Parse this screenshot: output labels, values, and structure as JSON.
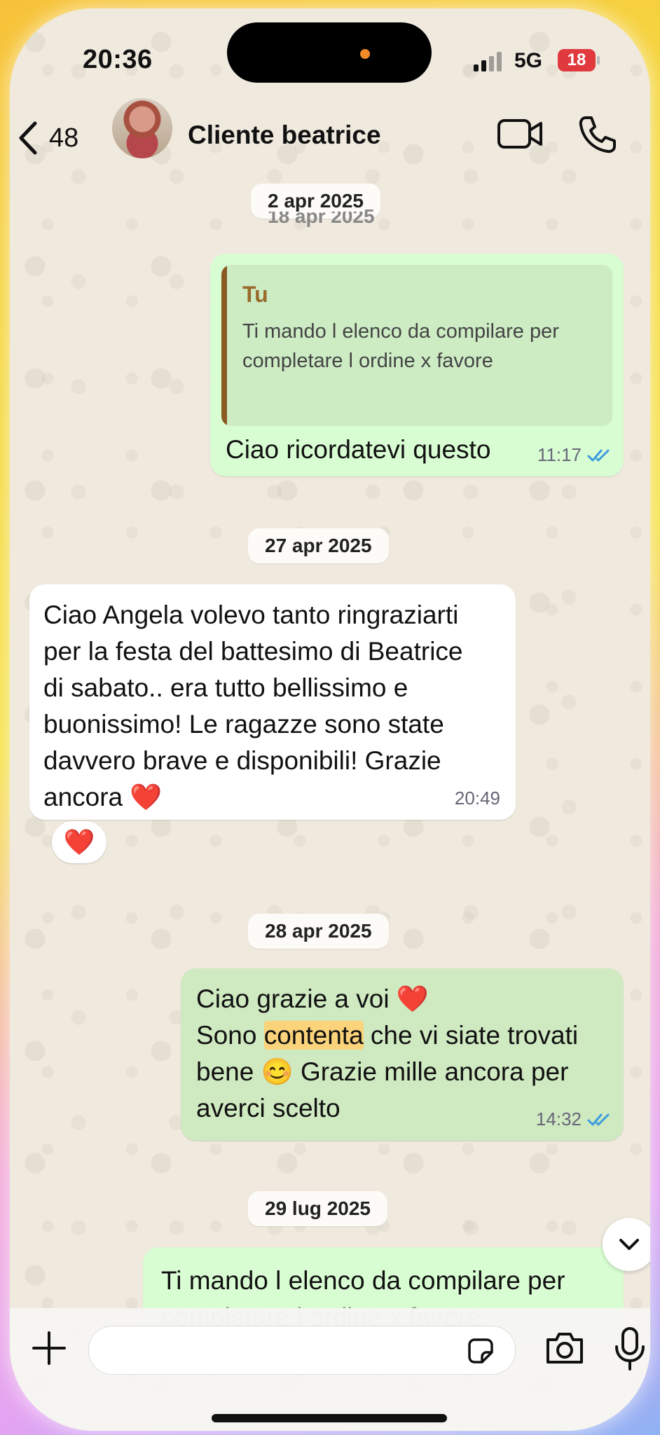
{
  "status_bar": {
    "time": "20:36",
    "network": "5G",
    "battery": "18"
  },
  "header": {
    "back_count": "48",
    "contact_name": "Cliente beatrice"
  },
  "dates": {
    "d1": "2 apr 2025",
    "d1_behind": "18 apr 2025",
    "d2": "27 apr 2025",
    "d3": "28 apr 2025",
    "d4": "29 lug 2025"
  },
  "messages": {
    "m1": {
      "quote_author": "Tu",
      "quote_text": "Ti mando l elenco da compilare per\ncompletare l ordine x favore",
      "text": "Ciao ricordatevi questo",
      "time": "11:17"
    },
    "m2": {
      "text": "Ciao Angela volevo tanto ringraziarti\nper la festa del battesimo di Beatrice\ndi sabato.. era tutto bellissimo e\nbuonissimo! Le ragazze sono state\ndavvero brave e disponibili! Grazie\nancora ❤️",
      "time": "20:49",
      "reaction": "❤️"
    },
    "m3": {
      "line1": "Ciao grazie a voi ❤️",
      "line2_pre": "Sono ",
      "line2_highlight": "contenta",
      "line2_post": " che vi siate trovati",
      "line3": "bene 😊 Grazie mille ancora per",
      "line4": "averci scelto",
      "time": "14:32"
    },
    "m4": {
      "text": "Ti mando l elenco da compilare per",
      "text_partial": "completare l ordine x favore"
    }
  },
  "colors": {
    "outgoing_bubble": "#d9fdd3",
    "incoming_bubble": "#ffffff",
    "read_ticks": "#3a9bdc",
    "quote_bar": "#8a5a22",
    "battery": "#e0393e"
  },
  "icons": {
    "back": "chevron-left-icon",
    "video": "video-camera-icon",
    "call": "phone-icon",
    "scroll_down": "chevron-down-icon",
    "plus": "plus-icon",
    "sticker": "sticker-icon",
    "camera": "camera-icon",
    "mic": "microphone-icon"
  }
}
